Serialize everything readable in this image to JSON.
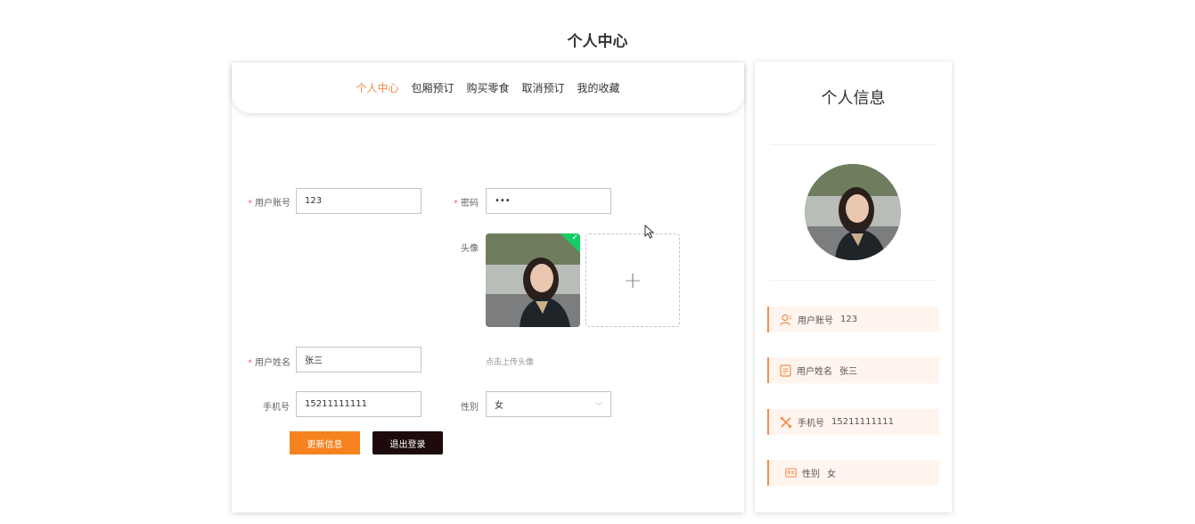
{
  "page": {
    "title": "个人中心"
  },
  "nav": {
    "tabs": [
      {
        "label": "个人中心",
        "active": true
      },
      {
        "label": "包厢预订",
        "active": false
      },
      {
        "label": "购买零食",
        "active": false
      },
      {
        "label": "取消预订",
        "active": false
      },
      {
        "label": "我的收藏",
        "active": false
      }
    ]
  },
  "form": {
    "account": {
      "label": "用户账号",
      "required": "*",
      "value": "123"
    },
    "password": {
      "label": "密码",
      "required": "*",
      "value": "•••"
    },
    "avatar": {
      "label": "头像",
      "upload_hint": "点击上传头像"
    },
    "name": {
      "label": "用户姓名",
      "required": "*",
      "value": "张三"
    },
    "phone": {
      "label": "手机号",
      "value": "15211111111"
    },
    "gender": {
      "label": "性别",
      "value": "女"
    },
    "update_label": "更新信息",
    "logout_label": "退出登录"
  },
  "profile": {
    "title": "个人信息",
    "rows": [
      {
        "icon": "user-icon",
        "label": "用户账号",
        "value": "123"
      },
      {
        "icon": "document-icon",
        "label": "用户姓名",
        "value": "张三"
      },
      {
        "icon": "tools-icon",
        "label": "手机号",
        "value": "15211111111"
      },
      {
        "icon": "id-card-icon",
        "label": "性别",
        "value": "女"
      }
    ]
  },
  "colors": {
    "accent": "#f08d49",
    "update_button": "#f6821f",
    "logout_button": "#1e0a0a",
    "required_mark": "#f56c6c",
    "upload_success": "#13ce66"
  }
}
